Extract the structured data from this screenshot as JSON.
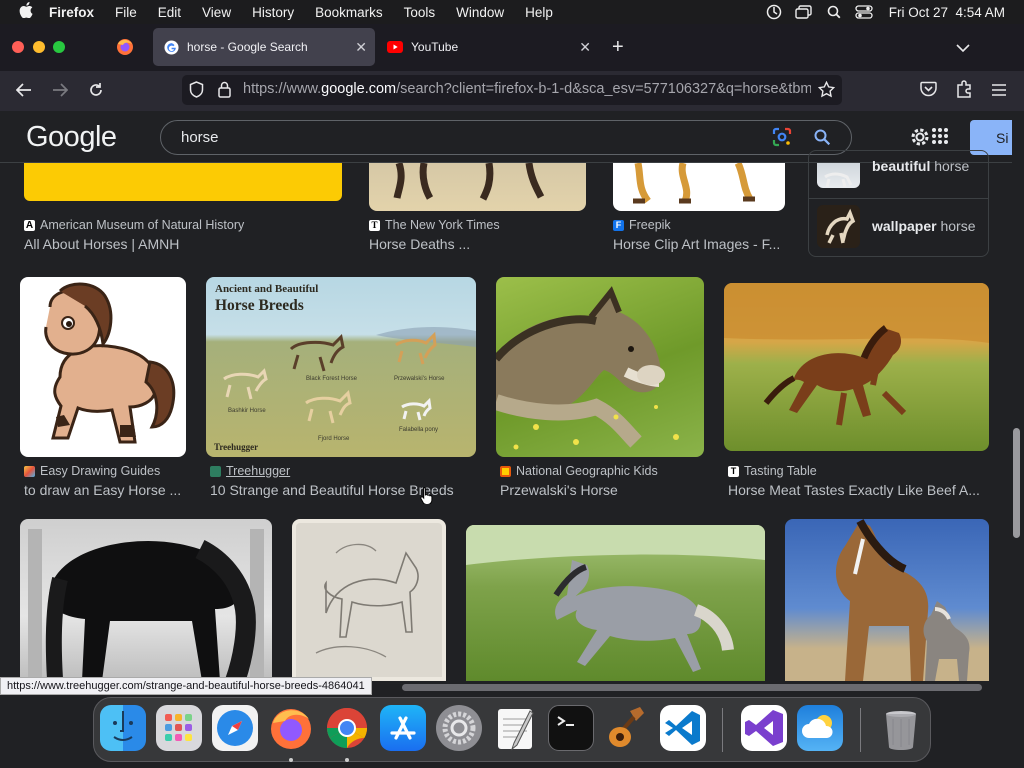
{
  "menubar": {
    "app": "Firefox",
    "items": [
      "File",
      "Edit",
      "View",
      "History",
      "Bookmarks",
      "Tools",
      "Window",
      "Help"
    ],
    "clock": "Fri Oct 27  4:54 AM"
  },
  "tabs": [
    {
      "label": "horse - Google Search",
      "active": true
    },
    {
      "label": "YouTube",
      "active": false
    }
  ],
  "urlbar": {
    "prefix": "https://www.",
    "host": "google.com",
    "path": "/search?client=firefox-b-1-d&sca_esv=577106327&q=horse&tbm"
  },
  "google": {
    "logo": "Google",
    "query": "horse",
    "signin": "Si"
  },
  "results_top": [
    {
      "source": "American Museum of Natural History",
      "title": "All About Horses | AMNH"
    },
    {
      "source": "The New York Times",
      "title": "Horse Deaths ..."
    },
    {
      "source": "Freepik",
      "title": "Horse Clip Art Images - F..."
    }
  ],
  "suggestions": [
    {
      "bold": "beautiful",
      "rest": " horse"
    },
    {
      "bold": "wallpaper",
      "rest": " horse"
    }
  ],
  "results_mid": [
    {
      "source": "Easy Drawing Guides",
      "title": "to draw an Easy Horse ..."
    },
    {
      "source": "Treehugger",
      "title": "10 Strange and Beautiful Horse Breeds"
    },
    {
      "source": "National Geographic Kids",
      "title": "Przewalski's Horse"
    },
    {
      "source": "Tasting Table",
      "title": "Horse Meat Tastes Exactly Like Beef A..."
    }
  ],
  "infographic": {
    "title1": "Ancient and Beautiful",
    "title2": "Horse Breeds",
    "labels": [
      "Black Forest Horse",
      "Przewalski's Horse",
      "Bashkir Horse",
      "Fjord Horse",
      "Falabella pony"
    ],
    "brand": "Treehugger"
  },
  "status_url": "https://www.treehugger.com/strange-and-beautiful-horse-breeds-4864041",
  "dock": [
    "finder",
    "launchpad",
    "safari",
    "firefox",
    "chrome",
    "app-store",
    "system-settings",
    "textedit",
    "terminal",
    "garageband",
    "vscode",
    "visual-studio",
    "weather",
    "trash"
  ]
}
